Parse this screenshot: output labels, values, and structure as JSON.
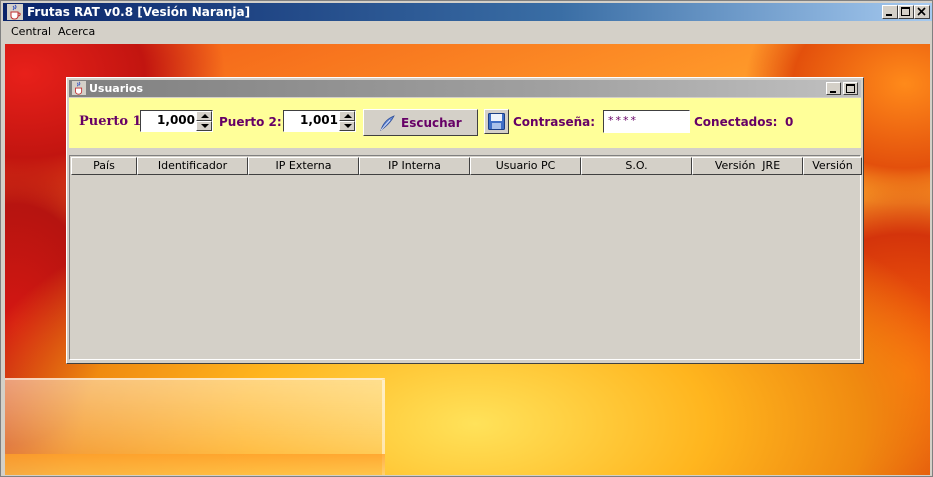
{
  "window": {
    "title": "Frutas RAT v0.8 [Vesión Naranja]"
  },
  "menubar": {
    "items": [
      "Central",
      "Acerca"
    ]
  },
  "internal_frame": {
    "title": "Usuarios",
    "puerto1_label": "Puerto 1:",
    "puerto1_value": "1,000",
    "puerto2_label": "Puerto 2:",
    "puerto2_value": "1,001",
    "listen_button": "Escuchar",
    "password_label": "Contraseña:",
    "password_value": "****",
    "connected_label": "Conectados:",
    "connected_count": "0"
  },
  "table": {
    "columns": [
      "País",
      "Identificador",
      "IP Externa",
      "IP Interna",
      "Usuario PC",
      "S.O.",
      "Versión  JRE",
      "Versión"
    ]
  },
  "icons": {
    "app": "java-cup-icon",
    "listen": "feather-icon",
    "save": "floppy-disk-icon"
  }
}
